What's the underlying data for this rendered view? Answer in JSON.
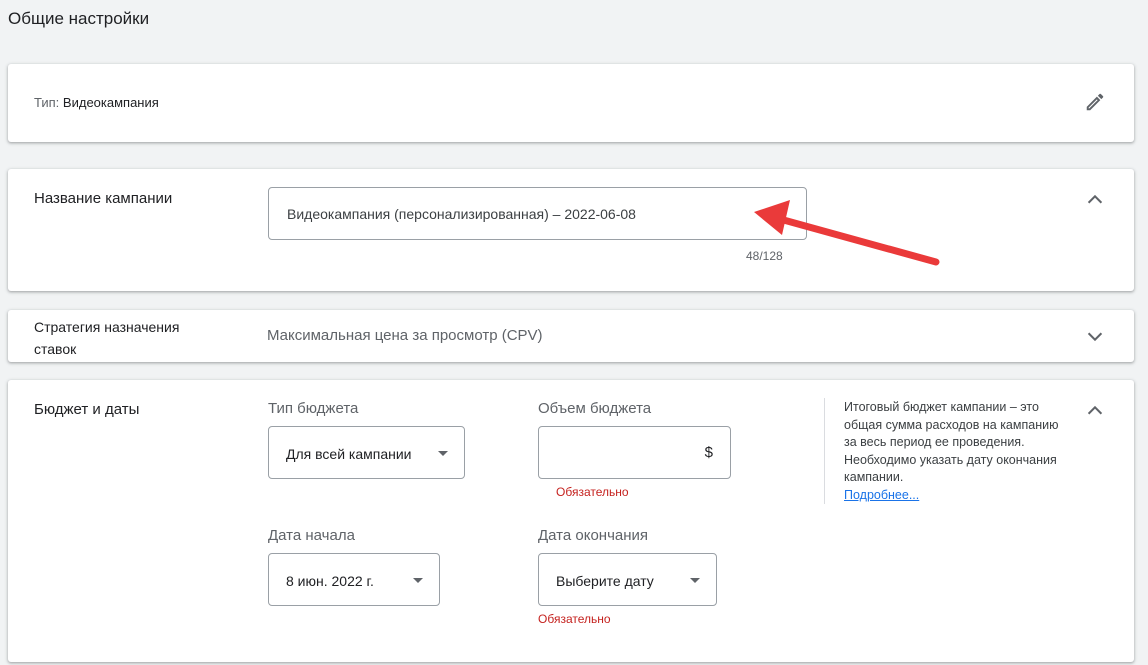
{
  "page": {
    "section_title": "Общие настройки"
  },
  "type_card": {
    "label": "Тип:",
    "value": "Видеокампания"
  },
  "campaign_name": {
    "label": "Название кампании",
    "value": "Видеокампания (персонализированная) – 2022-06-08",
    "counter": "48/128"
  },
  "bidding": {
    "label": "Стратегия назначения ставок",
    "value": "Максимальная цена за просмотр (CPV)"
  },
  "budget": {
    "label": "Бюджет и даты",
    "type_label": "Тип бюджета",
    "type_value": "Для всей кампании",
    "amount_label": "Объем бюджета",
    "currency": "$",
    "amount_required": "Обязательно",
    "start_label": "Дата начала",
    "start_value": "8 июн. 2022 г.",
    "end_label": "Дата окончания",
    "end_value": "Выберите дату",
    "end_required": "Обязательно",
    "help_text": "Итоговый бюджет кампании – это общая сумма расходов на кампанию за весь период ее проведения. Необходимо указать дату окончания кампании.",
    "help_link": "Подробнее..."
  },
  "colors": {
    "background": "#f1f3f4",
    "card": "#ffffff",
    "error": "#c5221f",
    "link": "#1a73e8",
    "annotation_arrow": "#ea3a3a"
  },
  "icons": {
    "edit": "pencil-icon",
    "expand_less": "chevron-up-icon",
    "expand_more": "chevron-down-icon",
    "dropdown": "triangle-down-icon"
  }
}
